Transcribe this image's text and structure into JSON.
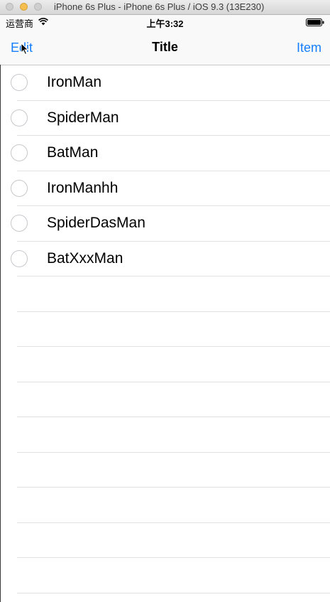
{
  "window": {
    "title": "iPhone 6s Plus - iPhone 6s Plus / iOS 9.3 (13E230)"
  },
  "status_bar": {
    "carrier": "运营商",
    "time": "上午3:32",
    "wifi_icon": "wifi-icon",
    "battery_icon": "battery-icon"
  },
  "nav": {
    "left_button": "Edit",
    "title": "Title",
    "right_button": "Item",
    "accent_color": "#147efb"
  },
  "table": {
    "rows": [
      {
        "label": "IronMan"
      },
      {
        "label": "SpiderMan"
      },
      {
        "label": "BatMan"
      },
      {
        "label": "IronManhh"
      },
      {
        "label": "SpiderDasMan"
      },
      {
        "label": "BatXxxMan"
      },
      {
        "label": ""
      },
      {
        "label": ""
      },
      {
        "label": ""
      },
      {
        "label": ""
      },
      {
        "label": ""
      },
      {
        "label": ""
      },
      {
        "label": ""
      },
      {
        "label": ""
      },
      {
        "label": ""
      },
      {
        "label": ""
      }
    ]
  }
}
